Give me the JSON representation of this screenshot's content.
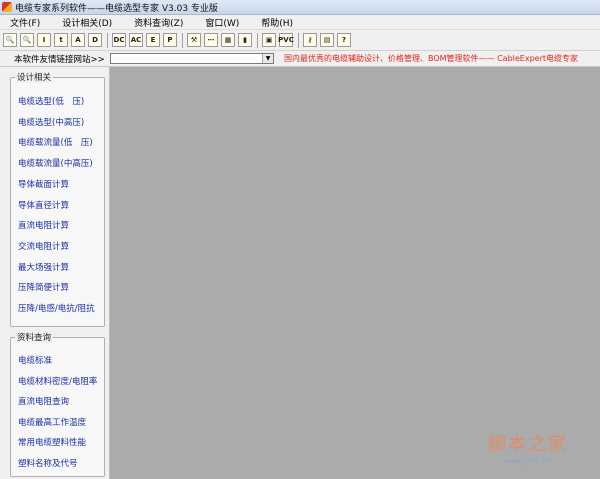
{
  "window": {
    "title": "电缆专家系列软件——电缆选型专家  V3.03 专业版"
  },
  "menu": [
    "文件(F)",
    "设计相关(D)",
    "资料查询(Z)",
    "窗口(W)",
    "帮助(H)"
  ],
  "toolbar": {
    "group1": [
      {
        "icon": "zoom-in-icon",
        "glyph": "🔍"
      },
      {
        "icon": "zoom-out-icon",
        "glyph": "🔍"
      },
      {
        "icon": "current-icon",
        "glyph": "I"
      },
      {
        "icon": "temperature-icon",
        "glyph": "t"
      },
      {
        "icon": "voltage-icon",
        "glyph": "A"
      },
      {
        "icon": "diameter-icon",
        "glyph": "D"
      }
    ],
    "group2": [
      {
        "icon": "dc-icon",
        "glyph": "DC"
      },
      {
        "icon": "ac-icon",
        "glyph": "AC"
      },
      {
        "icon": "field-icon",
        "glyph": "E"
      },
      {
        "icon": "power-icon",
        "glyph": "P"
      }
    ],
    "group3": [
      {
        "icon": "tools-icon",
        "glyph": "⚒"
      },
      {
        "icon": "network-icon",
        "glyph": "⋯"
      },
      {
        "icon": "layout-icon",
        "glyph": "▦"
      },
      {
        "icon": "book-icon",
        "glyph": "▮"
      }
    ],
    "group4": [
      {
        "icon": "database-icon",
        "glyph": "▣"
      },
      {
        "icon": "pvc-icon",
        "glyph": "PVC"
      }
    ],
    "group5": [
      {
        "icon": "key-icon",
        "glyph": "⚷"
      },
      {
        "icon": "document-icon",
        "glyph": "▤"
      },
      {
        "icon": "help-icon",
        "glyph": "?"
      }
    ]
  },
  "linkbar": {
    "label": "本软件友情链接网站>>",
    "select_value": "",
    "promo": "国内最优秀的电缆辅助设计、价格管理、BOM管理软件—— CableExpert电缆专家"
  },
  "sidebar": {
    "design": {
      "title": "设计相关",
      "items": [
        "电缆选型(低　压)",
        "电缆选型(中高压)",
        "电缆载流量(低　压)",
        "电缆载流量(中高压)",
        "导体截面计算",
        "导体直径计算",
        "直流电阻计算",
        "交流电阻计算",
        "最大场强计算",
        "压降简便计算",
        "压降/电感/电抗/阻抗"
      ]
    },
    "reference": {
      "title": "资料查询",
      "items": [
        "电缆标准",
        "电缆材料密度/电阻率",
        "直流电阻查询",
        "电缆最高工作温度",
        "常用电缆塑料性能",
        "塑料名称及代号"
      ]
    }
  },
  "watermark": {
    "title": "脚本之家",
    "url": "www.jb51.net"
  }
}
